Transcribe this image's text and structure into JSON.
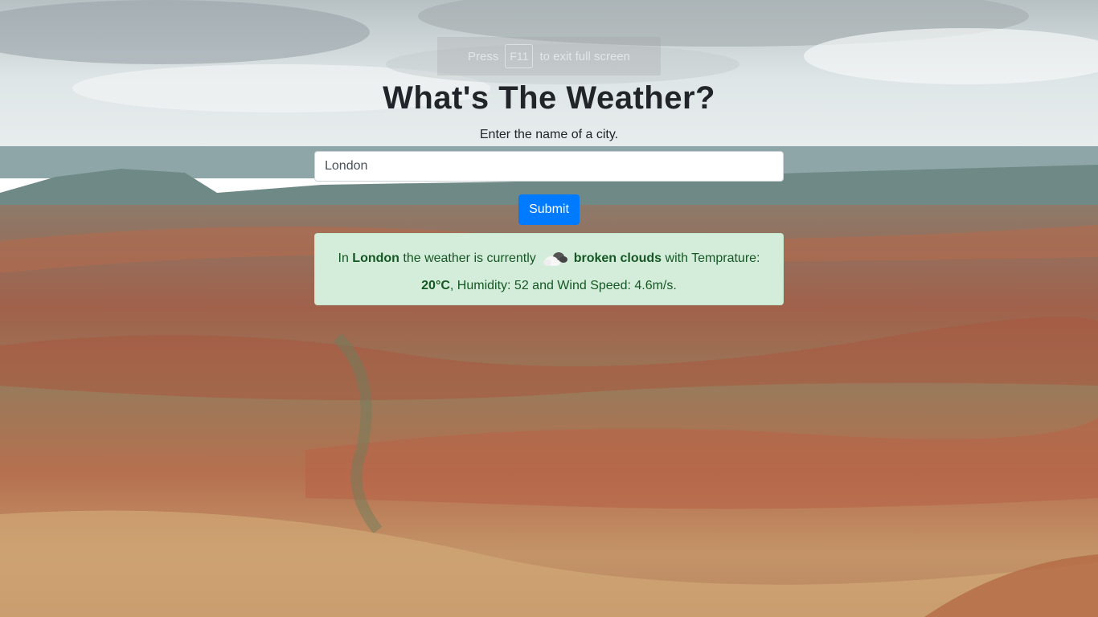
{
  "fullscreen_hint": {
    "before": "Press",
    "key": "F11",
    "after": "to exit full screen"
  },
  "page": {
    "title": "What's The Weather?",
    "subtitle": "Enter the name of a city."
  },
  "search": {
    "value": "London",
    "placeholder": ""
  },
  "submit_label": "Submit",
  "result": {
    "prefix": "In",
    "city": "London",
    "text1": "the weather is currently",
    "condition_icon": "broken-clouds-icon",
    "condition": "broken clouds",
    "text2": "with Temprature:",
    "temperature": "20°C",
    "text3": ", Humidity: 52 and Wind Speed: 4.6m/s."
  },
  "colors": {
    "accent": "#007bff",
    "alert_bg": "#d4edda",
    "alert_text": "#155724"
  }
}
